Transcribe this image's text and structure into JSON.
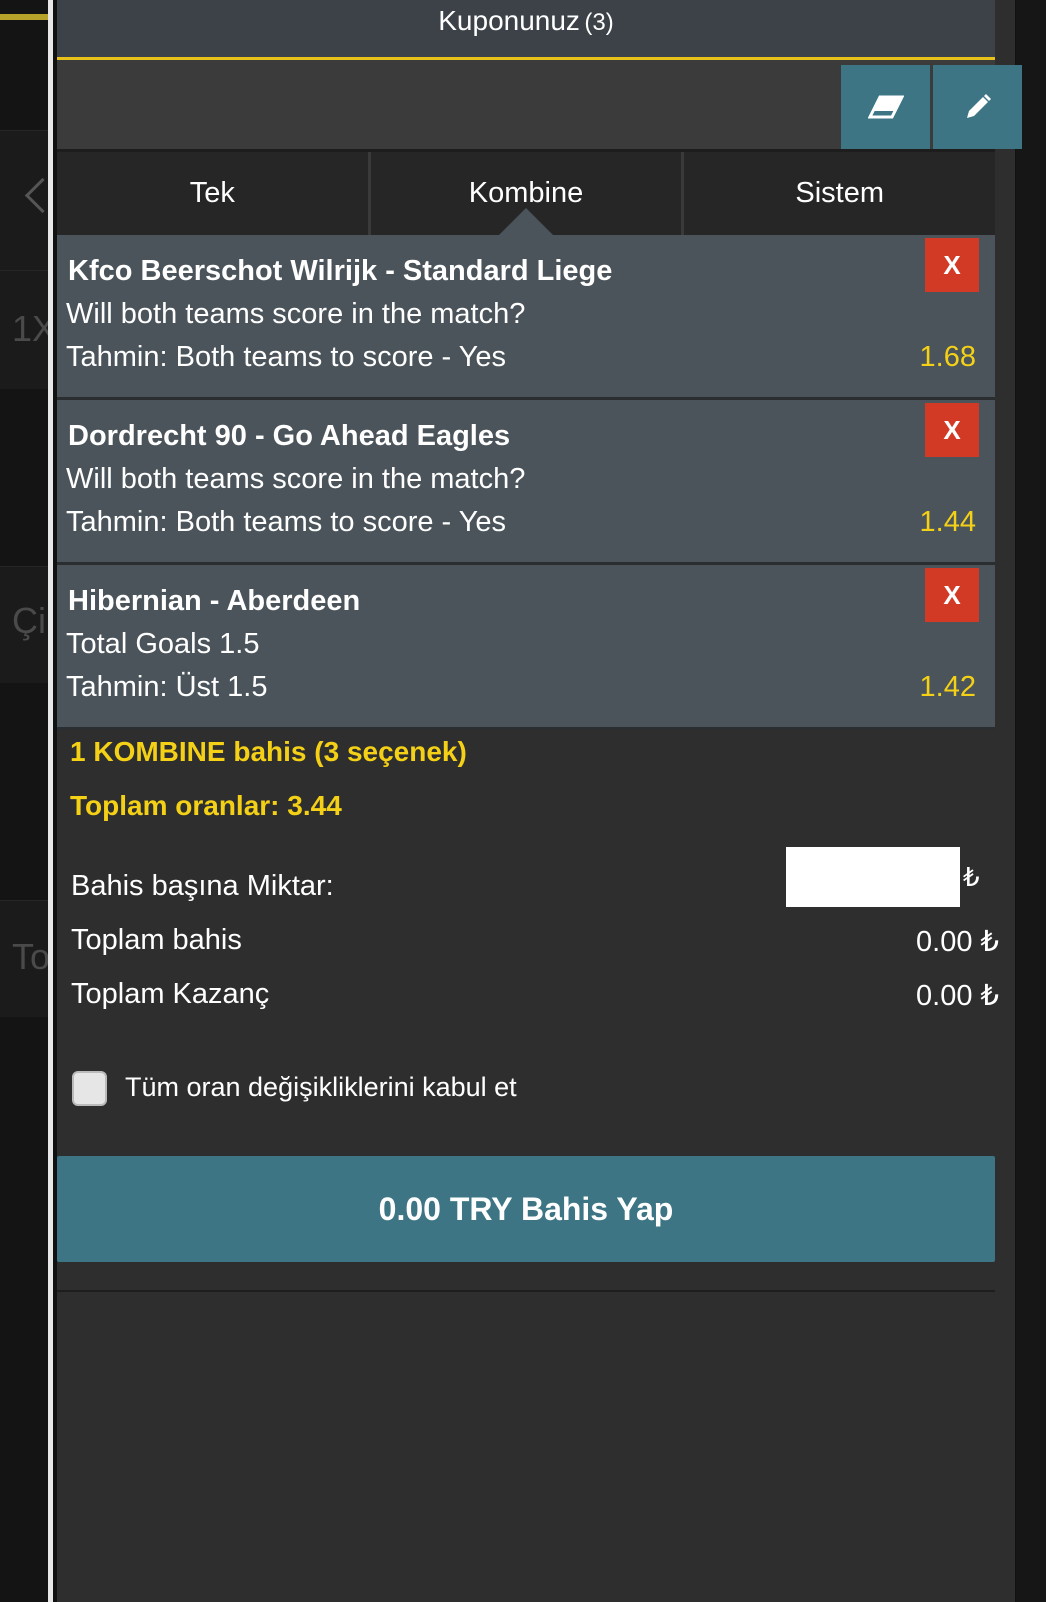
{
  "background": {
    "left_fragments": [
      "1X",
      "Çi",
      "To"
    ]
  },
  "header": {
    "title": "Kuponunuz",
    "count": "(3)"
  },
  "toolbar": {
    "buttons": [
      {
        "icon": "eraser-icon"
      },
      {
        "icon": "pencil-icon"
      }
    ]
  },
  "tabs": [
    {
      "label": "Tek",
      "active": false
    },
    {
      "label": "Kombine",
      "active": true
    },
    {
      "label": "Sistem",
      "active": false
    }
  ],
  "bets": [
    {
      "teams": "Kfco Beerschot Wilrijk - Standard Liege",
      "market": "Will both teams score in the match?",
      "prediction": "Tahmin: Both teams to score - Yes",
      "odds": "1.68",
      "remove": "X"
    },
    {
      "teams": "Dordrecht 90 - Go Ahead Eagles",
      "market": "Will both teams score in the match?",
      "prediction": "Tahmin: Both teams to score - Yes",
      "odds": "1.44",
      "remove": "X"
    },
    {
      "teams": "Hibernian - Aberdeen",
      "market": "Total Goals 1.5",
      "prediction": "Tahmin: Üst 1.5",
      "odds": "1.42",
      "remove": "X"
    }
  ],
  "summary": {
    "combo_line": "1 KOMBINE bahis (3 seçenek)",
    "total_odds": "Toplam oranlar: 3.44",
    "stake_label": "Bahis başına Miktar:",
    "stake_value": "",
    "currency_sign": "₺",
    "total_stake_label": "Toplam bahis",
    "total_stake_value": "0.00 ₺",
    "total_win_label": "Toplam Kazanç",
    "total_win_value": "0.00 ₺",
    "accept_changes_label": "Tüm oran değişikliklerini kabul et",
    "accept_changes_checked": false
  },
  "place_bet": {
    "label": "0.00 TRY Bahis Yap"
  },
  "colors": {
    "accent": "#3d7585",
    "odds": "#f4d116",
    "remove": "#d33a25",
    "header_underline": "#e8c21a"
  }
}
